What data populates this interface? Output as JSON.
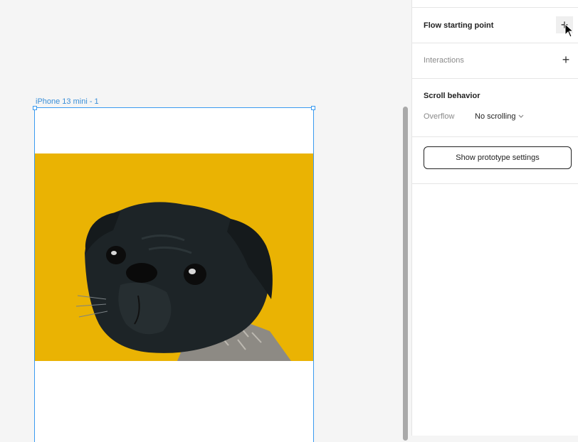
{
  "canvas": {
    "frame_label": "iPhone 13 mini - 1",
    "photo_fill_color": "#eab303",
    "selection_color": "#3a9af0"
  },
  "panel": {
    "flow_starting_point": {
      "label": "Flow starting point",
      "action_icon": "plus-icon"
    },
    "interactions": {
      "label": "Interactions",
      "action_icon": "plus-icon"
    },
    "scroll_behavior": {
      "title": "Scroll behavior",
      "overflow_label": "Overflow",
      "overflow_value": "No scrolling"
    },
    "show_prototype_settings_label": "Show prototype settings"
  }
}
